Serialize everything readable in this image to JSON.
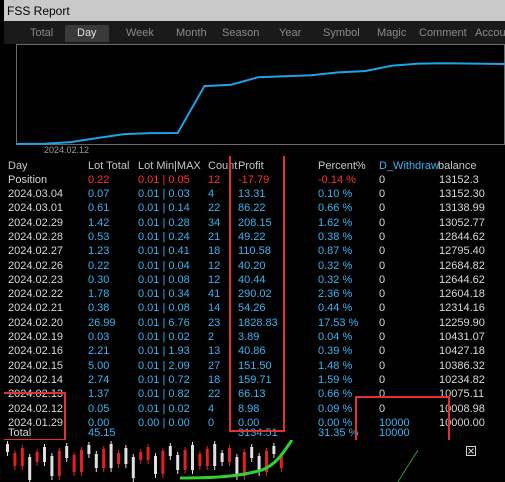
{
  "window": {
    "title": "FSS Report"
  },
  "tabs": [
    {
      "label": "Total",
      "active": false
    },
    {
      "label": "Day",
      "active": true
    },
    {
      "label": "Week",
      "active": false
    },
    {
      "label": "Month",
      "active": false
    },
    {
      "label": "Season",
      "active": false
    },
    {
      "label": "Year",
      "active": false
    },
    {
      "label": "Symbol",
      "active": false
    },
    {
      "label": "Magic",
      "active": false
    },
    {
      "label": "Comment",
      "active": false
    },
    {
      "label": "Accou",
      "active": false
    }
  ],
  "chart_data": {
    "type": "line",
    "x": [
      "2024.01.29",
      "2024.02.12",
      "2024.02.13",
      "2024.02.14",
      "2024.02.15",
      "2024.02.16",
      "2024.02.19",
      "2024.02.20",
      "2024.02.21",
      "2024.02.22",
      "2024.02.23",
      "2024.02.26",
      "2024.02.27",
      "2024.02.28",
      "2024.02.29",
      "2024.03.01",
      "2024.03.04"
    ],
    "values": [
      10000.0,
      10008.98,
      10075.11,
      10234.82,
      10386.32,
      10427.18,
      10431.07,
      12259.9,
      12314.16,
      12604.18,
      12644.62,
      12684.82,
      12795.4,
      12844.62,
      13052.77,
      13138.99,
      13152.3
    ],
    "x_tick_label": "2024.02.12",
    "color": "#1fa2e6"
  },
  "table": {
    "headers": {
      "day": "Day",
      "lot_total": "Lot Total",
      "lot_minmax": "Lot Min|MAX",
      "count": "Count",
      "profit": "Profit",
      "percent": "Percent%",
      "withdraw": "D_Withdraw",
      "balance": "balance"
    },
    "position": {
      "day": "Position",
      "lot_total": "0.22",
      "lot_minmax": "0.01 | 0.05",
      "count": "12",
      "profit": "-17.79",
      "percent": "-0.14 %",
      "withdraw": "0",
      "balance": "13152.3"
    },
    "rows": [
      {
        "day": "2024.03.04",
        "lot_total": "0.07",
        "lot_minmax": "0.01 | 0.03",
        "count": "4",
        "profit": "13.31",
        "percent": "0.10 %",
        "withdraw": "0",
        "balance": "13152.30"
      },
      {
        "day": "2024.03.01",
        "lot_total": "0.61",
        "lot_minmax": "0.01 | 0.14",
        "count": "22",
        "profit": "86.22",
        "percent": "0.66 %",
        "withdraw": "0",
        "balance": "13138.99"
      },
      {
        "day": "2024.02.29",
        "lot_total": "1.42",
        "lot_minmax": "0.01 | 0.28",
        "count": "34",
        "profit": "208.15",
        "percent": "1.62 %",
        "withdraw": "0",
        "balance": "13052.77"
      },
      {
        "day": "2024.02.28",
        "lot_total": "0.53",
        "lot_minmax": "0.01 | 0.24",
        "count": "21",
        "profit": "49.22",
        "percent": "0.38 %",
        "withdraw": "0",
        "balance": "12844.62"
      },
      {
        "day": "2024.02.27",
        "lot_total": "1.23",
        "lot_minmax": "0.01 | 0.41",
        "count": "18",
        "profit": "110.58",
        "percent": "0.87 %",
        "withdraw": "0",
        "balance": "12795.40"
      },
      {
        "day": "2024.02.26",
        "lot_total": "0.22",
        "lot_minmax": "0.01 | 0.04",
        "count": "12",
        "profit": "40.20",
        "percent": "0.32 %",
        "withdraw": "0",
        "balance": "12684.82"
      },
      {
        "day": "2024.02.23",
        "lot_total": "0.30",
        "lot_minmax": "0.01 | 0.08",
        "count": "12",
        "profit": "40.44",
        "percent": "0.32 %",
        "withdraw": "0",
        "balance": "12644.62"
      },
      {
        "day": "2024.02.22",
        "lot_total": "1.78",
        "lot_minmax": "0.01 | 0.34",
        "count": "41",
        "profit": "290.02",
        "percent": "2.36 %",
        "withdraw": "0",
        "balance": "12604.18"
      },
      {
        "day": "2024.02.21",
        "lot_total": "0.38",
        "lot_minmax": "0.01 | 0.08",
        "count": "14",
        "profit": "54.26",
        "percent": "0.44 %",
        "withdraw": "0",
        "balance": "12314.16"
      },
      {
        "day": "2024.02.20",
        "lot_total": "26.99",
        "lot_minmax": "0.01 | 6.76",
        "count": "23",
        "profit": "1828.83",
        "percent": "17.53 %",
        "withdraw": "0",
        "balance": "12259.90"
      },
      {
        "day": "2024.02.19",
        "lot_total": "0.03",
        "lot_minmax": "0.01 | 0.02",
        "count": "2",
        "profit": "3.89",
        "percent": "0.04 %",
        "withdraw": "0",
        "balance": "10431.07"
      },
      {
        "day": "2024.02.16",
        "lot_total": "2.21",
        "lot_minmax": "0.01 | 1.93",
        "count": "13",
        "profit": "40.86",
        "percent": "0.39 %",
        "withdraw": "0",
        "balance": "10427.18"
      },
      {
        "day": "2024.02.15",
        "lot_total": "5.00",
        "lot_minmax": "0.01 | 2.09",
        "count": "27",
        "profit": "151.50",
        "percent": "1.48 %",
        "withdraw": "0",
        "balance": "10386.32"
      },
      {
        "day": "2024.02.14",
        "lot_total": "2.74",
        "lot_minmax": "0.01 | 0.72",
        "count": "18",
        "profit": "159.71",
        "percent": "1.59 %",
        "withdraw": "0",
        "balance": "10234.82"
      },
      {
        "day": "2024.02.13",
        "lot_total": "1.37",
        "lot_minmax": "0.01 | 0.82",
        "count": "22",
        "profit": "66.13",
        "percent": "0.66 %",
        "withdraw": "0",
        "balance": "10075.11"
      },
      {
        "day": "2024.02.12",
        "lot_total": "0.05",
        "lot_minmax": "0.01 | 0.02",
        "count": "4",
        "profit": "8.98",
        "percent": "0.09 %",
        "withdraw": "0",
        "balance": "10008.98"
      },
      {
        "day": "2024.01.29",
        "lot_total": "0.00",
        "lot_minmax": "0.00 | 0.00",
        "count": "0",
        "profit": "0.00",
        "percent": "0.00 %",
        "withdraw": "10000",
        "balance": "10000.00"
      }
    ],
    "total": {
      "day": "Total",
      "lot_total": "45.15",
      "lot_minmax": "",
      "count": "",
      "profit": "3134.51",
      "percent": "31.35 %",
      "withdraw": "10000",
      "balance": ""
    }
  },
  "colors": {
    "blue": "#3ab4f2",
    "red": "#ff3030",
    "highlight": "#e53030",
    "candle_up": "#e0e0e0",
    "candle_down": "#e52020",
    "ma_line": "#2fd02f"
  },
  "icons": {
    "chart_close": "close-box-icon"
  }
}
